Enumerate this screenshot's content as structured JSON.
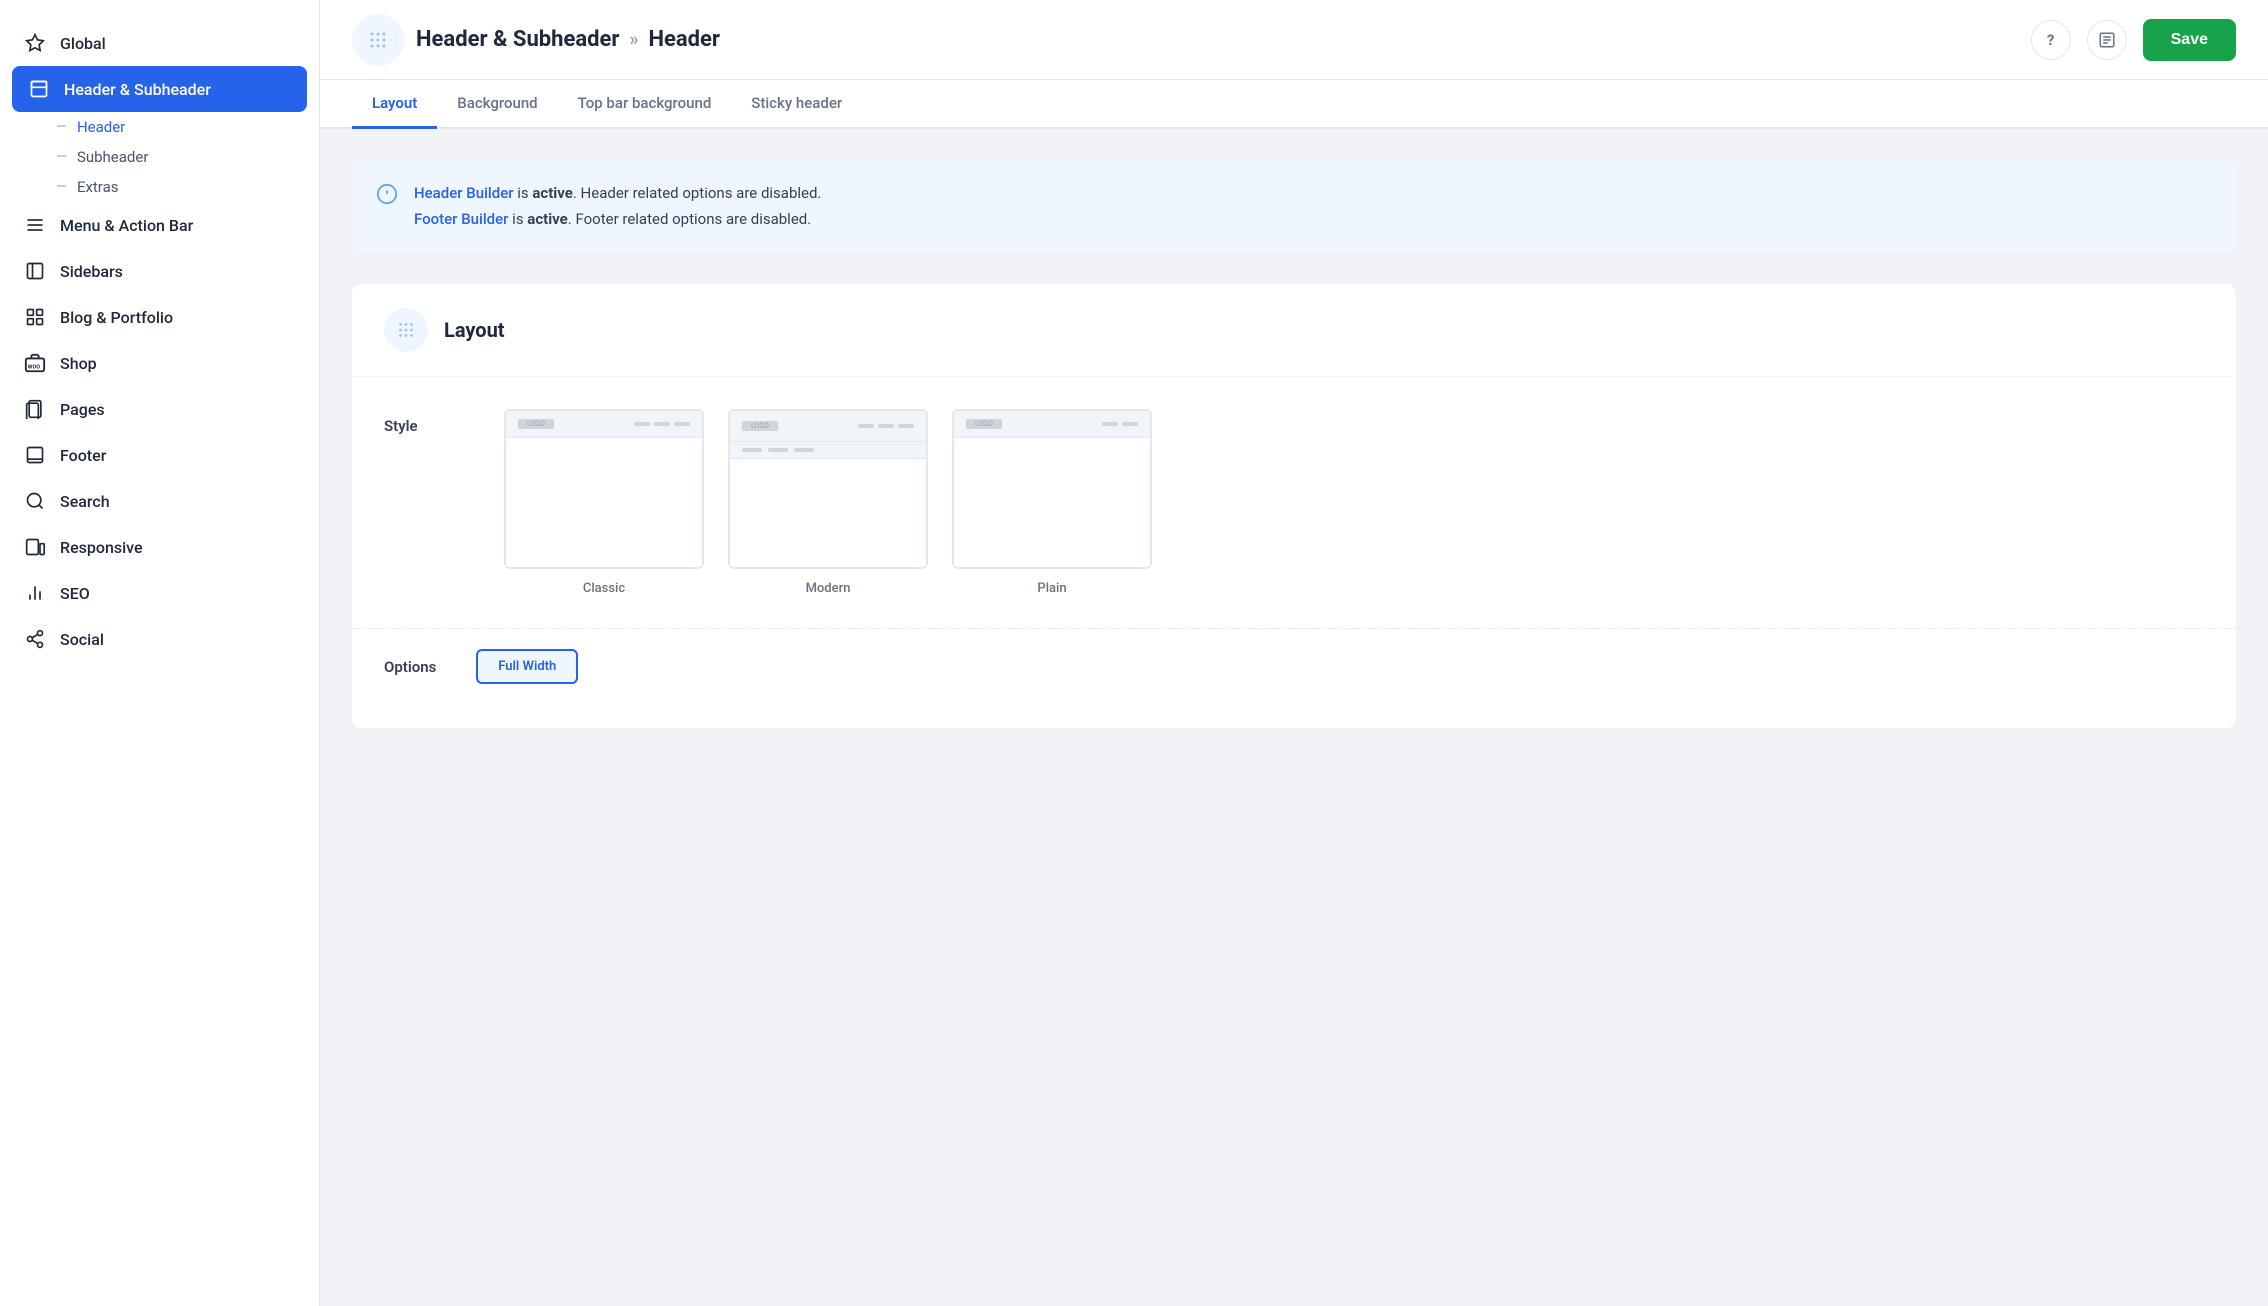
{
  "sidebar": {
    "items": [
      {
        "id": "global",
        "label": "Global",
        "icon": "star"
      },
      {
        "id": "header-subheader",
        "label": "Header & Subheader",
        "icon": "layout",
        "active": true,
        "children": [
          {
            "id": "header",
            "label": "Header",
            "active": true
          },
          {
            "id": "subheader",
            "label": "Subheader"
          },
          {
            "id": "extras",
            "label": "Extras"
          }
        ]
      },
      {
        "id": "menu-action-bar",
        "label": "Menu & Action Bar",
        "icon": "menu"
      },
      {
        "id": "sidebars",
        "label": "Sidebars",
        "icon": "sidebars"
      },
      {
        "id": "blog-portfolio",
        "label": "Blog & Portfolio",
        "icon": "blog"
      },
      {
        "id": "shop",
        "label": "Shop",
        "icon": "shop"
      },
      {
        "id": "pages",
        "label": "Pages",
        "icon": "pages"
      },
      {
        "id": "footer",
        "label": "Footer",
        "icon": "footer"
      },
      {
        "id": "search",
        "label": "Search",
        "icon": "search"
      },
      {
        "id": "responsive",
        "label": "Responsive",
        "icon": "responsive"
      },
      {
        "id": "seo",
        "label": "SEO",
        "icon": "seo"
      },
      {
        "id": "social",
        "label": "Social",
        "icon": "social"
      }
    ]
  },
  "header": {
    "breadcrumb_parent": "Header & Subheader",
    "breadcrumb_child": "Header",
    "separator": "»"
  },
  "tabs": [
    {
      "id": "layout",
      "label": "Layout",
      "active": true
    },
    {
      "id": "background",
      "label": "Background"
    },
    {
      "id": "top-bar-background",
      "label": "Top bar background"
    },
    {
      "id": "sticky-header",
      "label": "Sticky header"
    }
  ],
  "info_banner": {
    "link1_text": "Header Builder",
    "link1_msg": " is ",
    "link1_status": "active",
    "link1_suffix": ". Header related options are disabled.",
    "link2_text": "Footer Builder",
    "link2_msg": " is ",
    "link2_status": "active",
    "link2_suffix": ". Footer related options are disabled."
  },
  "layout_section": {
    "title": "Layout",
    "style_label": "Style",
    "options_label": "Options",
    "styles": [
      {
        "id": "classic",
        "label": "Classic"
      },
      {
        "id": "modern",
        "label": "Modern"
      },
      {
        "id": "plain",
        "label": "Plain"
      }
    ],
    "options_pills": [
      {
        "id": "full-width",
        "label": "Full Width",
        "active": true
      }
    ]
  },
  "save_button": "Save",
  "help_icon": "?",
  "notes_icon": "≡"
}
